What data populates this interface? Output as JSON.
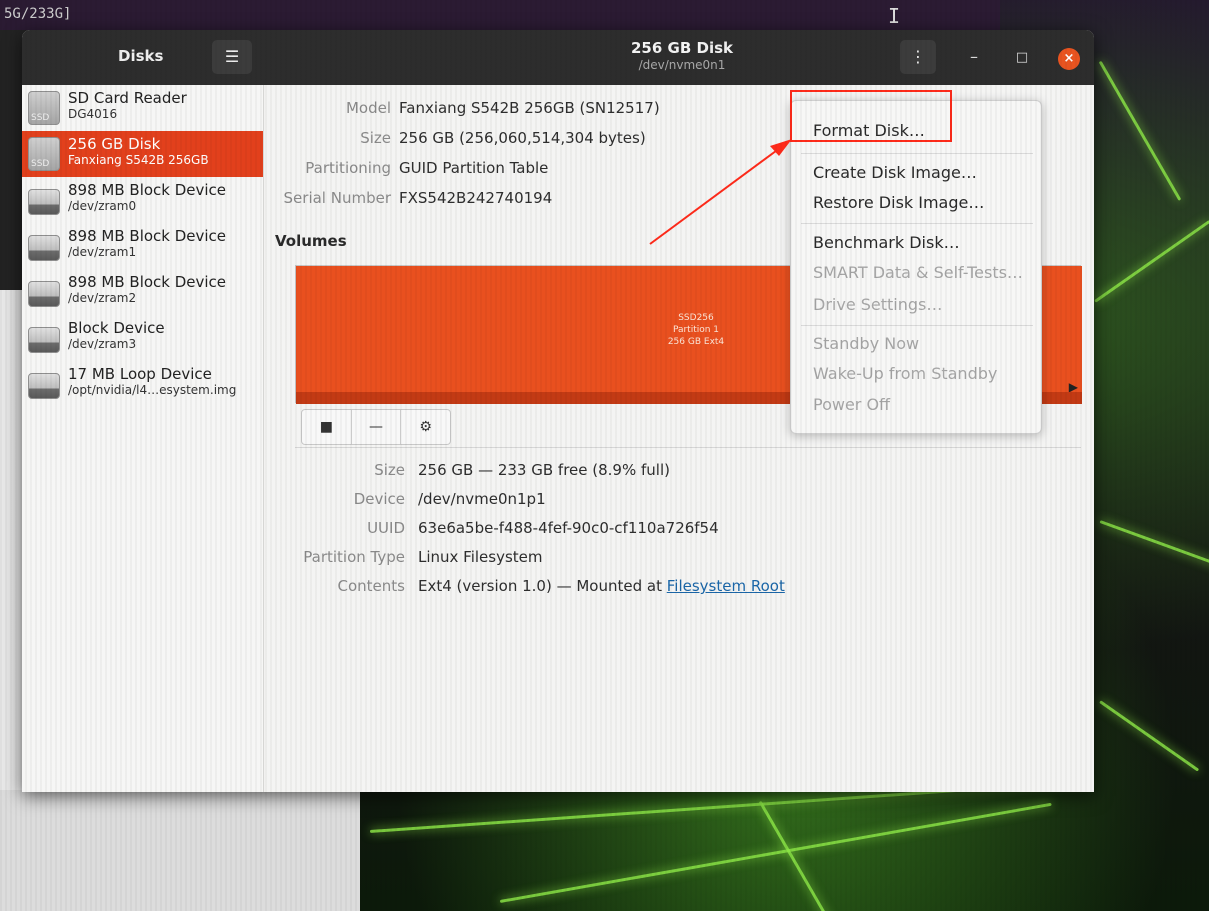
{
  "background": {
    "terminal_text": "5G/233G]",
    "cursor_glyph": "I"
  },
  "window": {
    "app_title": "Disks",
    "menu_icon": "hamburger-icon",
    "title": "256 GB Disk",
    "subtitle": "/dev/nvme0n1",
    "kebab_icon": "kebab-icon",
    "accent_color": "#e95420"
  },
  "sidebar": {
    "items": [
      {
        "name": "SD Card Reader",
        "sub": "DG4016",
        "tag": "SSD",
        "selected": false
      },
      {
        "name": "256 GB Disk",
        "sub": "Fanxiang S542B 256GB",
        "tag": "SSD",
        "selected": true
      },
      {
        "name": "898 MB Block Device",
        "sub": "/dev/zram0",
        "tag": "",
        "selected": false
      },
      {
        "name": "898 MB Block Device",
        "sub": "/dev/zram1",
        "tag": "",
        "selected": false
      },
      {
        "name": "898 MB Block Device",
        "sub": "/dev/zram2",
        "tag": "",
        "selected": false
      },
      {
        "name": "Block Device",
        "sub": "/dev/zram3",
        "tag": "",
        "selected": false
      },
      {
        "name": "17 MB Loop Device",
        "sub": "/opt/nvidia/l4…esystem.img",
        "tag": "",
        "selected": false
      }
    ]
  },
  "drive_info": {
    "model_label": "Model",
    "model": "Fanxiang S542B 256GB (SN12517)",
    "size_label": "Size",
    "size": "256 GB (256,060,514,304 bytes)",
    "partitioning_label": "Partitioning",
    "partitioning": "GUID Partition Table",
    "serial_label": "Serial Number",
    "serial": "FXS542B242740194"
  },
  "volumes": {
    "heading": "Volumes",
    "partition_line1": "SSD256",
    "partition_line2": "Partition 1",
    "partition_line3": "256 GB Ext4",
    "tools": [
      "■",
      "—",
      "⚙"
    ]
  },
  "partition_info": {
    "size_label": "Size",
    "size": "256 GB — 233 GB free (8.9% full)",
    "device_label": "Device",
    "device": "/dev/nvme0n1p1",
    "uuid_label": "UUID",
    "uuid": "63e6a5be-f488-4fef-90c0-cf110a726f54",
    "type_label": "Partition Type",
    "type": "Linux Filesystem",
    "contents_label": "Contents",
    "contents": "Ext4 (version 1.0) — Mounted at",
    "contents_link": "Filesystem Root"
  },
  "menu": {
    "format_disk": "Format Disk…",
    "create_image": "Create Disk Image…",
    "restore_image": "Restore Disk Image…",
    "benchmark": "Benchmark Disk…",
    "smart": "SMART Data & Self-Tests…",
    "drive_settings": "Drive Settings…",
    "standby": "Standby Now",
    "wakeup": "Wake-Up from Standby",
    "power_off": "Power Off"
  }
}
